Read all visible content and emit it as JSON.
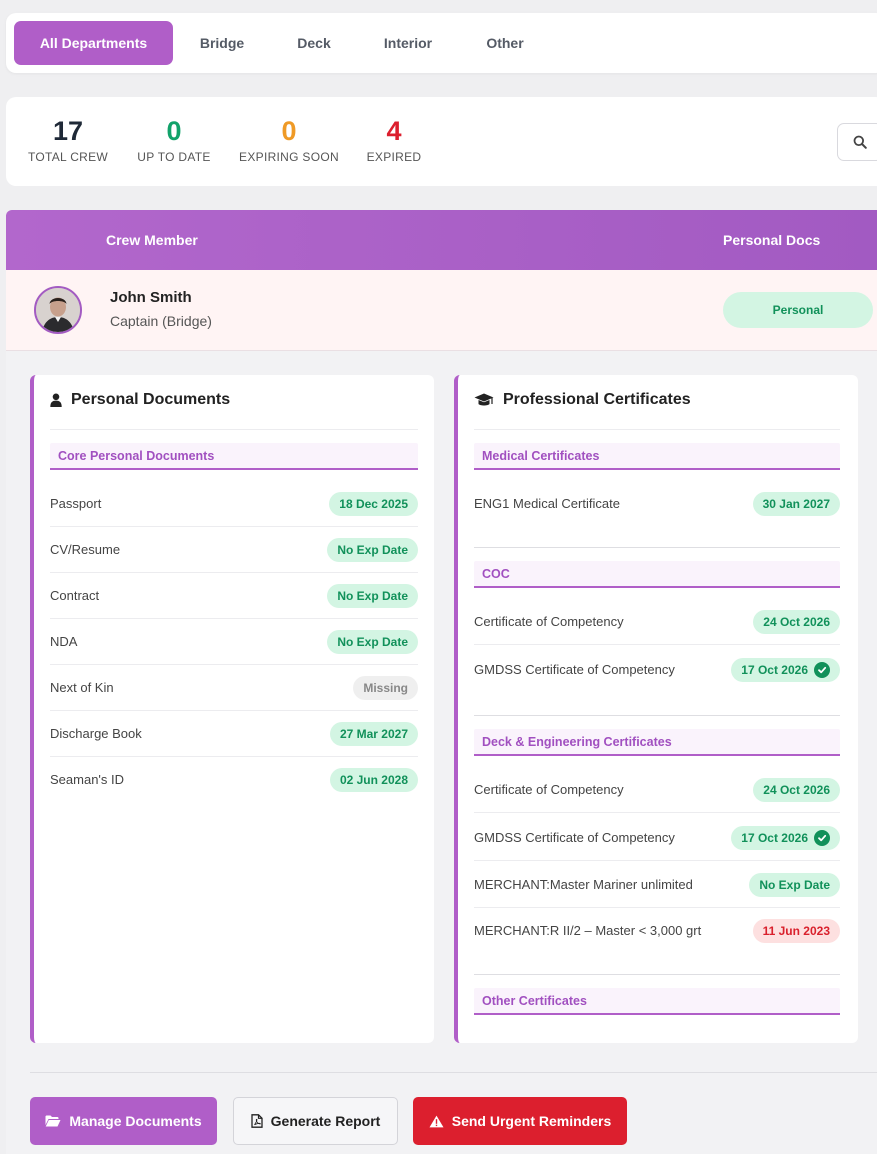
{
  "tabs": [
    "All Departments",
    "Bridge",
    "Deck",
    "Interior",
    "Other"
  ],
  "stats": [
    {
      "value": "17",
      "label": "TOTAL CREW",
      "color": "#1f2937"
    },
    {
      "value": "0",
      "label": "UP TO DATE",
      "color": "#12a26a"
    },
    {
      "value": "0",
      "label": "EXPIRING SOON",
      "color": "#ef9a26"
    },
    {
      "value": "4",
      "label": "EXPIRED",
      "color": "#dc1f2e"
    }
  ],
  "table_header": {
    "crew": "Crew Member",
    "personal_docs": "Personal Docs"
  },
  "crew": {
    "name": "John Smith",
    "role": "Captain (Bridge)",
    "personal_status": "Personal"
  },
  "personal_panel": {
    "title": "Personal Documents",
    "section": "Core Personal Documents",
    "docs": [
      {
        "name": "Passport",
        "status": "18 Dec 2025"
      },
      {
        "name": "CV/Resume",
        "status": "No Exp Date"
      },
      {
        "name": "Contract",
        "status": "No Exp Date"
      },
      {
        "name": "NDA",
        "status": "No Exp Date"
      },
      {
        "name": "Next of Kin",
        "status": "Missing"
      },
      {
        "name": "Discharge Book",
        "status": "27 Mar 2027"
      },
      {
        "name": "Seaman's ID",
        "status": "02 Jun 2028"
      }
    ]
  },
  "professional_panel": {
    "title": "Professional Certificates",
    "sections": [
      {
        "title": "Medical Certificates",
        "docs": [
          {
            "name": "ENG1 Medical Certificate",
            "status": "30 Jan 2027"
          }
        ]
      },
      {
        "title": "COC",
        "docs": [
          {
            "name": "Certificate of Competency",
            "status": "24 Oct 2026"
          },
          {
            "name": "GMDSS Certificate of Competency",
            "status": "17 Oct 2026"
          }
        ]
      },
      {
        "title": "Deck & Engineering Certificates",
        "docs": [
          {
            "name": "Certificate of Competency",
            "status": "24 Oct 2026"
          },
          {
            "name": "GMDSS Certificate of Competency",
            "status": "17 Oct 2026"
          },
          {
            "name": "MERCHANT:Master Mariner unlimited",
            "status": "No Exp Date"
          },
          {
            "name": "MERCHANT:R II/2 – Master < 3,000 grt",
            "status": "11 Jun 2023"
          }
        ]
      },
      {
        "title": "Other Certificates",
        "docs": []
      }
    ]
  },
  "actions": {
    "manage": "Manage Documents",
    "report": "Generate Report",
    "remind": "Send Urgent Reminders"
  }
}
